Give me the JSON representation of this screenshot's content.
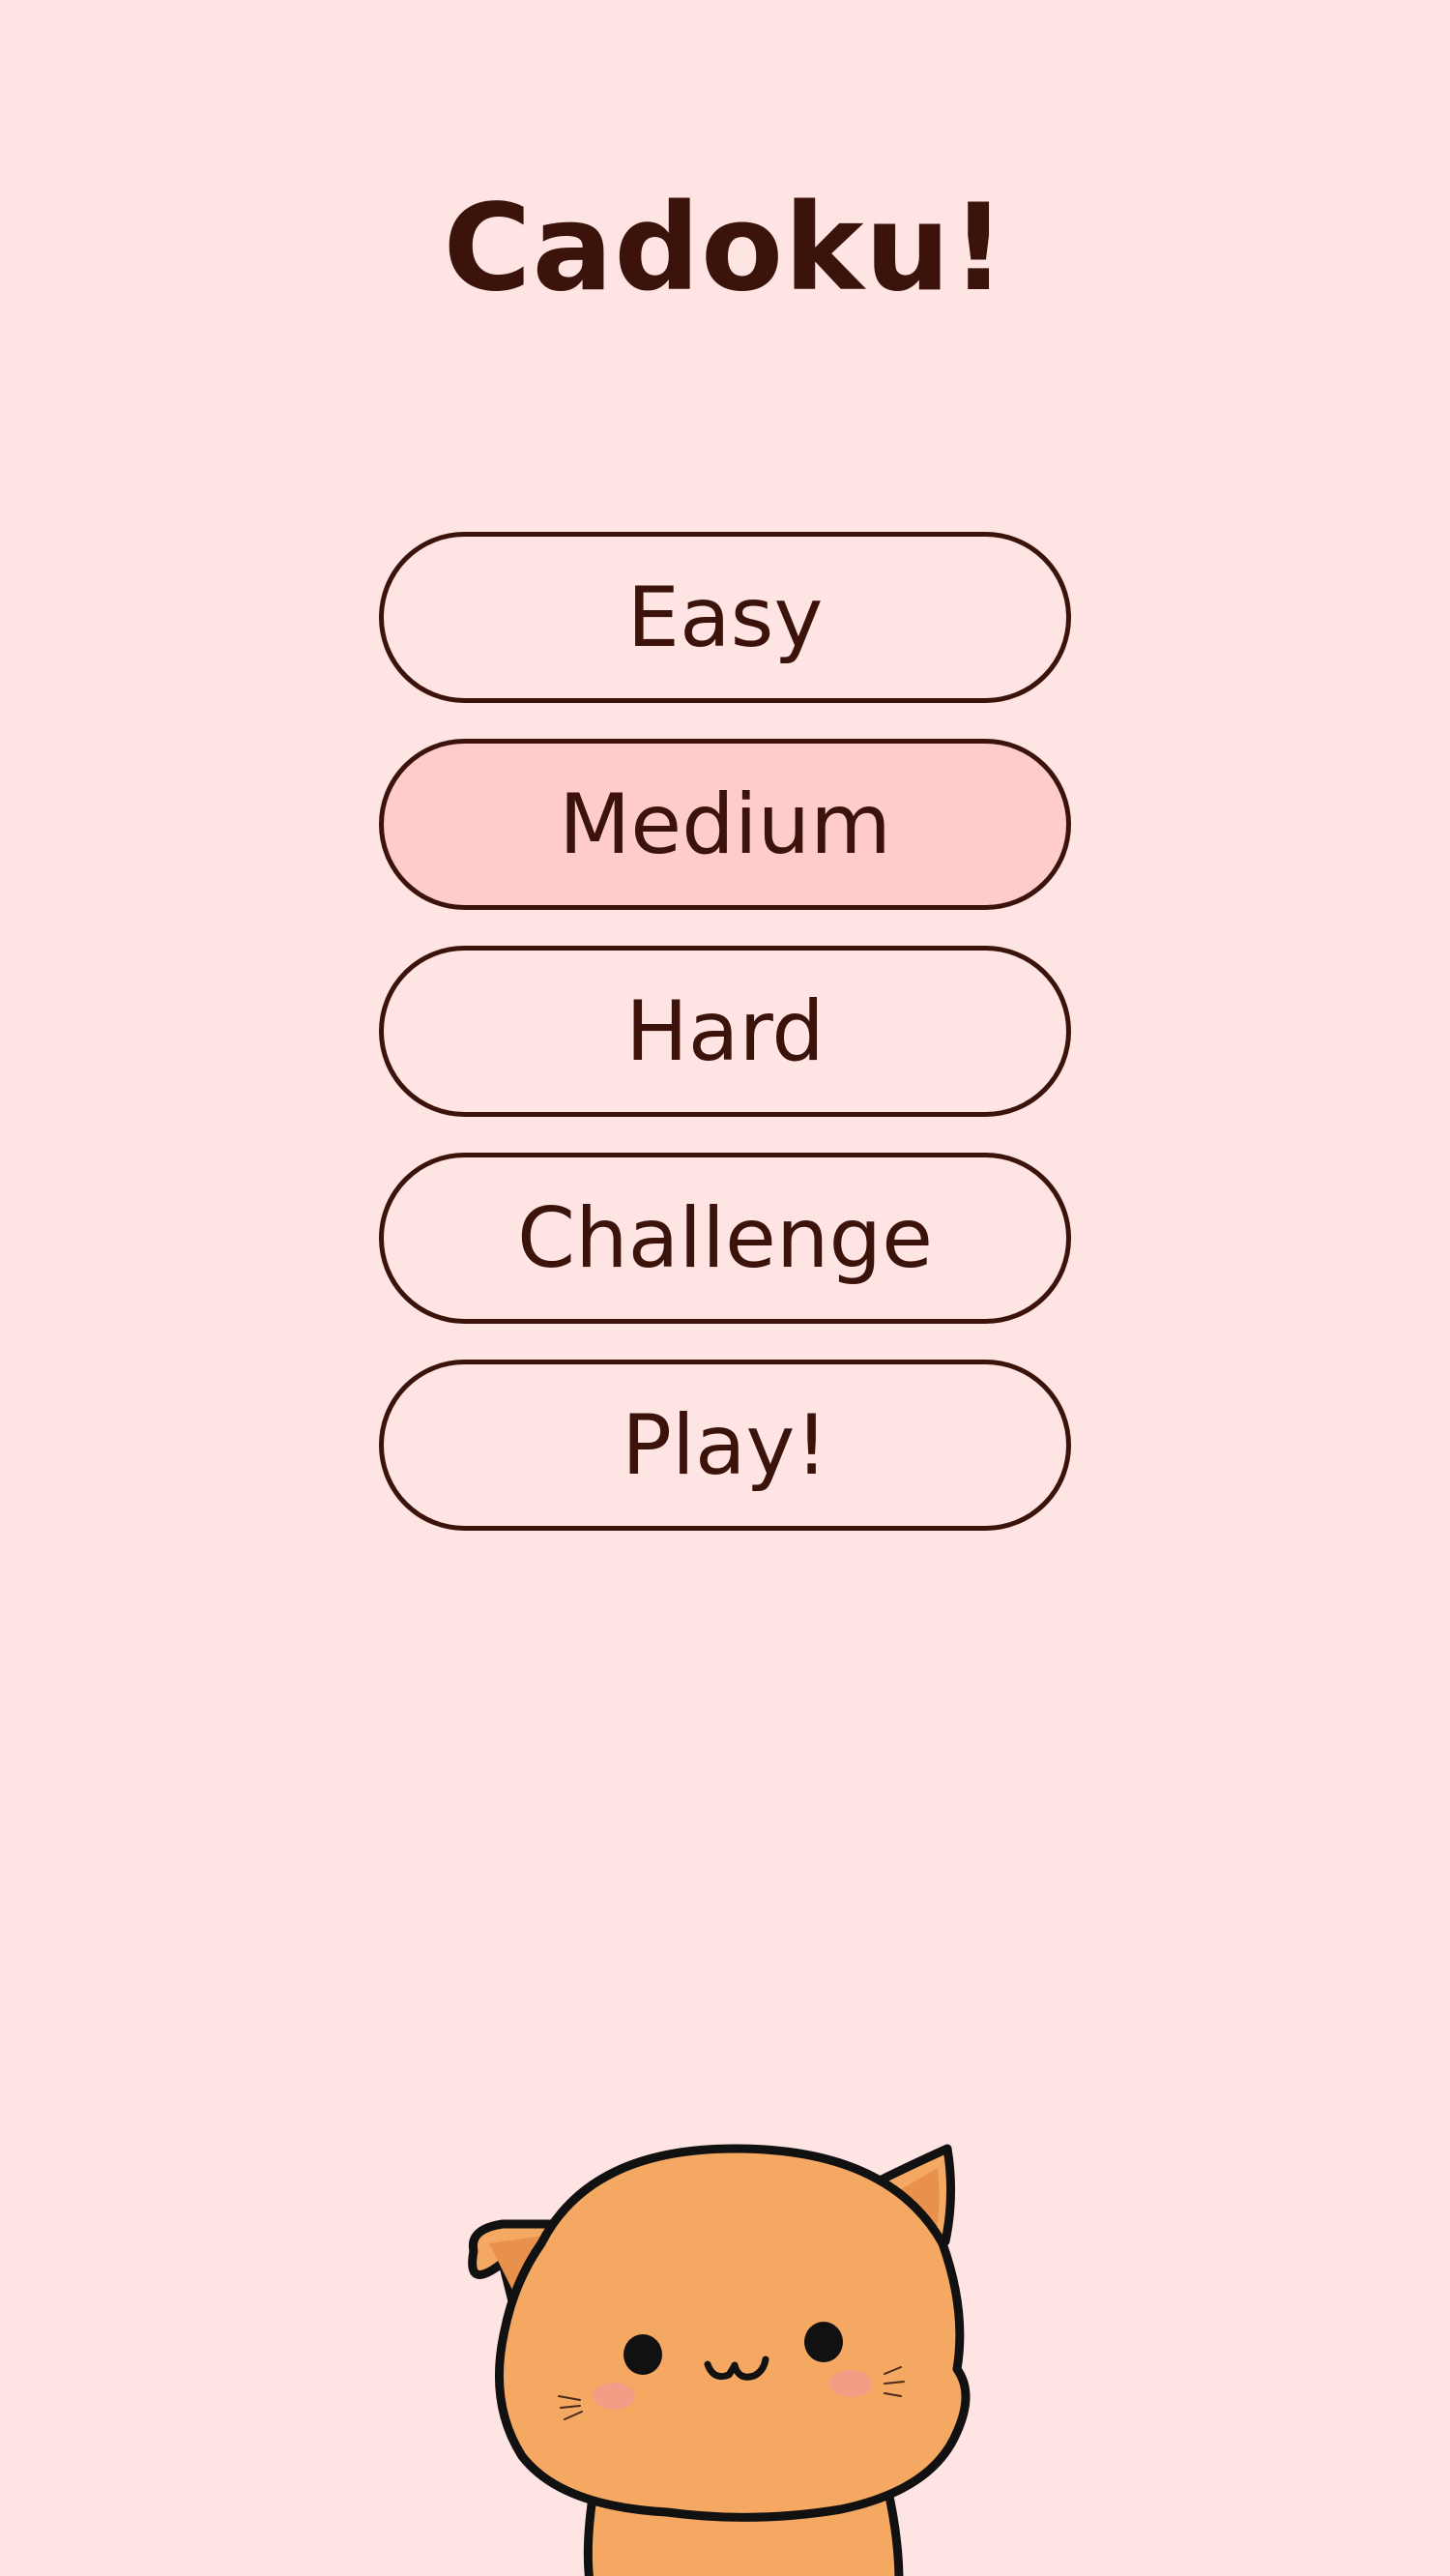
{
  "app": {
    "title": "Cadoku!"
  },
  "menu": {
    "options": [
      {
        "label": "Easy",
        "selected": false
      },
      {
        "label": "Medium",
        "selected": true
      },
      {
        "label": "Hard",
        "selected": false
      },
      {
        "label": "Challenge",
        "selected": false
      },
      {
        "label": "Play!",
        "selected": false
      }
    ]
  },
  "colors": {
    "background": "#ffe4e4",
    "text": "#3b130b",
    "selected_fill": "#ffcccc",
    "cat_fur": "#f4a862",
    "cat_blush": "#f59a8e"
  },
  "mascot": {
    "icon": "cat-mascot-icon"
  }
}
